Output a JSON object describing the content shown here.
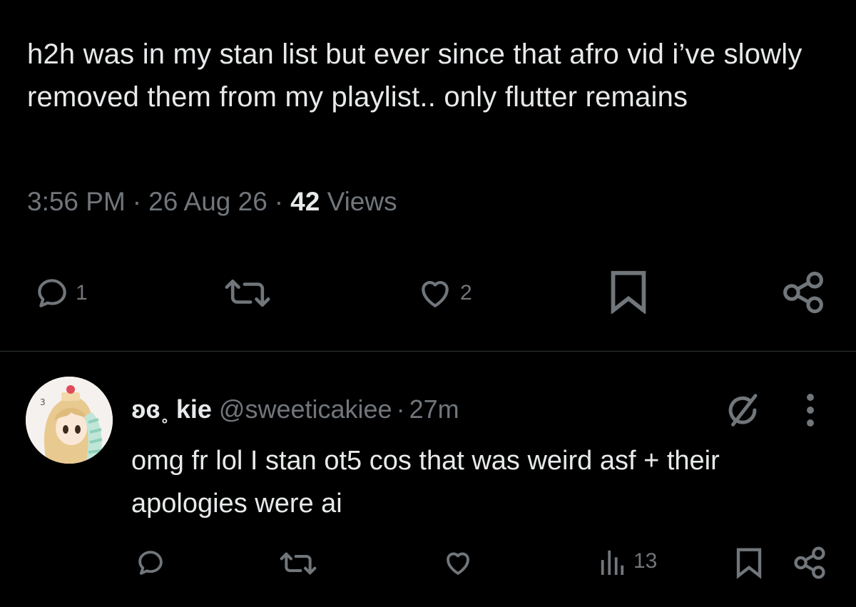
{
  "tweet": {
    "text": "h2h was in my stan list but ever since that afro vid i’ve slowly removed them from my playlist.. only flutter remains",
    "time": "3:56 PM",
    "date": "26 Aug 26",
    "views_count": "42",
    "views_label": "Views",
    "actions": {
      "reply_count": "1",
      "like_count": "2"
    }
  },
  "reply": {
    "display_name": "ʚɞ˳ kie",
    "handle": "@sweeticakiee",
    "time": "27m",
    "text": "omg fr lol I stan ot5 cos that was weird asf + their apologies were ai",
    "views_count": "13"
  },
  "colors": {
    "background": "#000000",
    "text": "#e7e9ea",
    "muted": "#71767b",
    "divider": "#2f3336"
  },
  "icons": [
    "reply-icon",
    "retweet-icon",
    "like-icon",
    "bookmark-icon",
    "share-icon",
    "grok-icon",
    "more-icon",
    "views-icon"
  ]
}
